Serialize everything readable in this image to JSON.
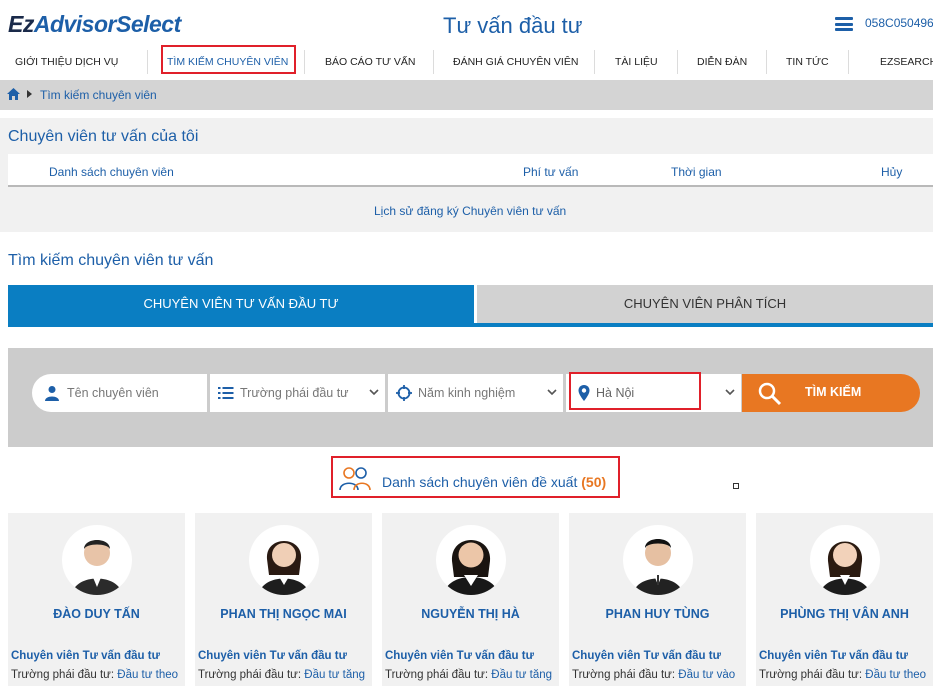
{
  "header": {
    "logo_prefix": "Ez",
    "logo_brand": "AdvisorSelect",
    "title": "Tư vấn đầu tư",
    "menu_icon": "hamburger-icon",
    "account_code": "058C050496"
  },
  "nav": {
    "items": [
      {
        "label": "Giới thiệu dịch vụ"
      },
      {
        "label": "Tìm kiếm chuyên viên"
      },
      {
        "label": "Báo cáo tư vấn"
      },
      {
        "label": "Đánh giá chuyên viên"
      },
      {
        "label": "Tài liệu"
      },
      {
        "label": "Diễn đàn"
      },
      {
        "label": "Tin tức"
      },
      {
        "label": "EzSearch"
      }
    ],
    "active_index": 1
  },
  "breadcrumb": {
    "home_icon": "home-icon",
    "current": "Tìm kiếm chuyên viên"
  },
  "my_advisors": {
    "title": "Chuyên viên tư vấn của tôi",
    "columns": [
      "Danh sách chuyên viên",
      "Phí tư vấn",
      "Thời gian",
      "Hủy"
    ],
    "history_link": "Lịch sử đăng ký Chuyên viên tư vấn"
  },
  "search": {
    "title": "Tìm kiếm chuyên viên tư vấn",
    "tabs": [
      "Chuyên viên tư vấn đầu tư",
      "Chuyên viên phân tích"
    ],
    "active_tab": 0,
    "fields": {
      "name_placeholder": "Tên chuyên viên",
      "style_placeholder": "Trường phái đầu tư",
      "experience_placeholder": "Năm kinh nghiệm",
      "location_value": "Hà Nội"
    },
    "button_label": "Tìm kiếm"
  },
  "suggested": {
    "label": "Danh sách chuyên viên đề xuất",
    "count": "(50)"
  },
  "advisors": [
    {
      "name": "ĐÀO DUY TẤN",
      "role": "Chuyên viên Tư vấn đầu tư",
      "style_label": "Trường phái đầu tư:",
      "style_value": "Đầu tư theo"
    },
    {
      "name": "PHAN THỊ NGỌC MAI",
      "role": "Chuyên viên Tư vấn đầu tư",
      "style_label": "Trường phái đầu tư:",
      "style_value": "Đầu tư tăng"
    },
    {
      "name": "NGUYỄN THỊ HÀ",
      "role": "Chuyên viên Tư vấn đầu tư",
      "style_label": "Trường phái đầu tư:",
      "style_value": "Đầu tư tăng"
    },
    {
      "name": "PHAN HUY TÙNG",
      "role": "Chuyên viên Tư vấn đầu tư",
      "style_label": "Trường phái đầu tư:",
      "style_value": "Đầu tư vào"
    },
    {
      "name": "PHÙNG THỊ VÂN ANH",
      "role": "Chuyên viên Tư vấn đầu tư",
      "style_label": "Trường phái đầu tư:",
      "style_value": "Đầu tư theo"
    }
  ],
  "colors": {
    "primary": "#1d5fa8",
    "tab_active": "#0a7ec2",
    "accent_orange": "#e87722",
    "highlight_red": "#e0202a"
  }
}
